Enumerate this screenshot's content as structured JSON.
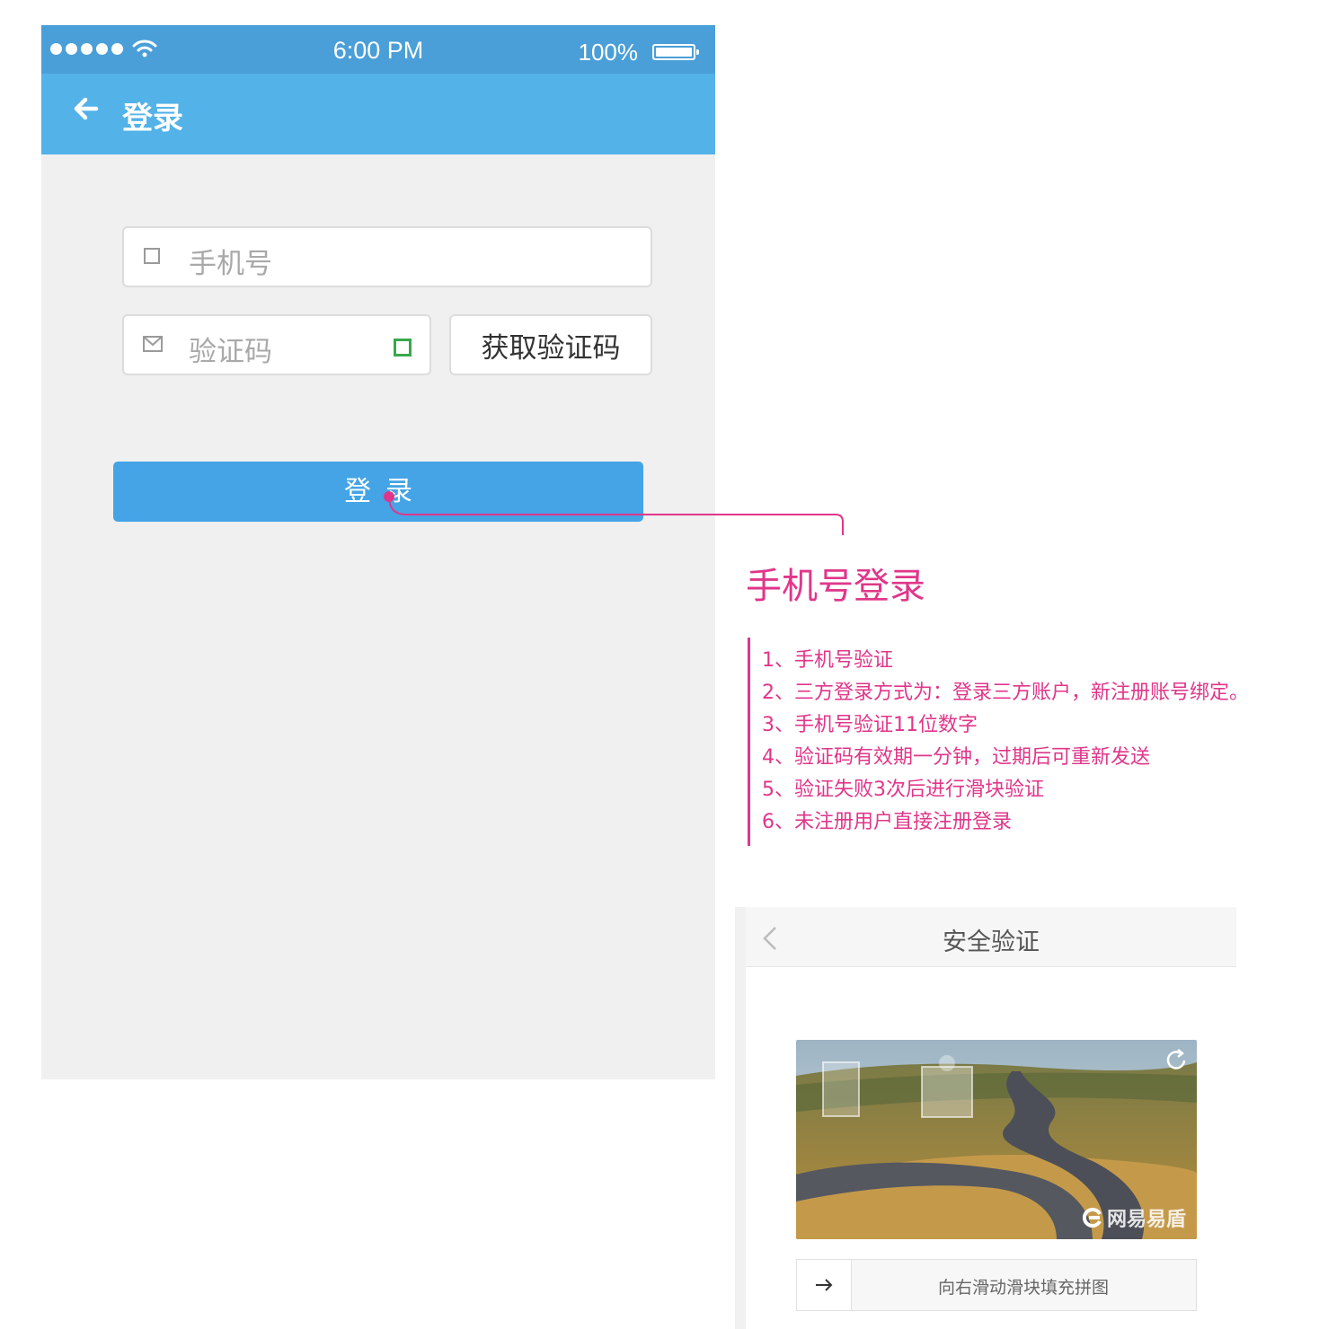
{
  "status_bar": {
    "time": "6:00 PM",
    "battery": "100%"
  },
  "nav": {
    "title": "登录"
  },
  "form": {
    "phone_placeholder": "手机号",
    "code_placeholder": "验证码",
    "get_code_label": "获取验证码",
    "login_label": "登录"
  },
  "annotation": {
    "title": "手机号登录",
    "items": [
      "1、手机号验证",
      "2、三方登录方式为：登录三方账户，新注册账号绑定。",
      "3、手机号验证11位数字",
      "4、验证码有效期一分钟，过期后可重新发送",
      "5、验证失败3次后进行滑块验证",
      "6、未注册用户直接注册登录"
    ],
    "color": "#e0368a"
  },
  "captcha": {
    "title": "安全验证",
    "watermark": "网易易盾",
    "slider_hint": "向右滑动滑块填充拼图"
  },
  "colors": {
    "status_bar": "#4a9fd8",
    "nav_bar": "#53b2e8",
    "button": "#44a4e6"
  }
}
